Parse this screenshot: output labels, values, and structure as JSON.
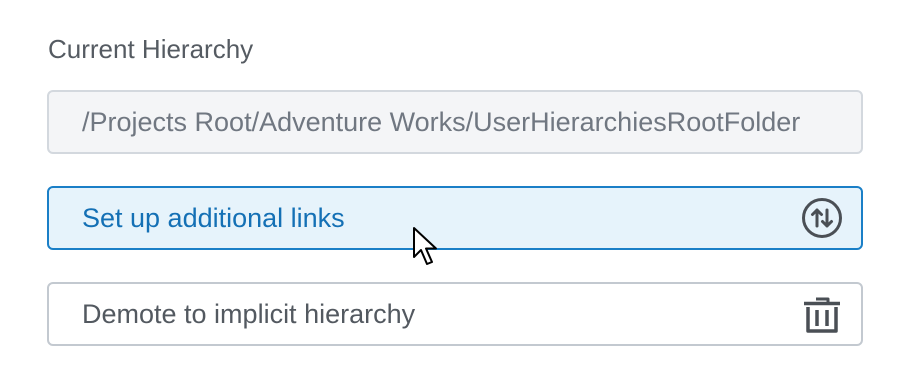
{
  "hierarchy": {
    "label": "Current Hierarchy",
    "path": "/Projects Root/Adventure Works/UserHierarchiesRootFolder"
  },
  "actions": [
    {
      "label": "Set up additional links",
      "icon": "swap-vertical-circle-icon",
      "state": "hover"
    },
    {
      "label": "Demote to implicit hierarchy",
      "icon": "trash-icon"
    }
  ],
  "colors": {
    "accent": "#1470b5",
    "hover_background": "#e6f3fb",
    "hover_border": "#1a7fc7",
    "muted_text": "#535960",
    "field_background": "#f4f5f7"
  }
}
